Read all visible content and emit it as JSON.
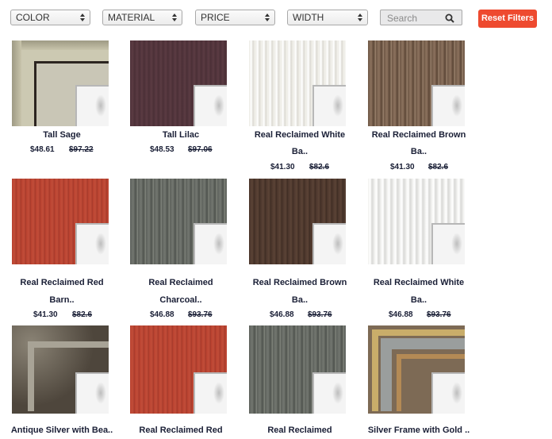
{
  "filters": {
    "color_label": "COLOR",
    "material_label": "MATERIAL",
    "price_label": "PRICE",
    "width_label": "WIDTH",
    "search_placeholder": "Search",
    "reset_label": "Reset Filters",
    "reset_color": "#ee4a2f"
  },
  "products": [
    {
      "name": "Tall Sage",
      "name2": "",
      "price": "$48.61",
      "old": "$97.22"
    },
    {
      "name": "Tall Lilac",
      "name2": "",
      "price": "$48.53",
      "old": "$97.06"
    },
    {
      "name": "Real Reclaimed White",
      "name2": "Ba..",
      "price": "$41.30",
      "old": "$82.6"
    },
    {
      "name": "Real Reclaimed Brown",
      "name2": "Ba..",
      "price": "$41.30",
      "old": "$82.6"
    },
    {
      "name": "Real Reclaimed Red",
      "name2": "Barn..",
      "price": "$41.30",
      "old": "$82.6"
    },
    {
      "name": "Real Reclaimed",
      "name2": "Charcoal..",
      "price": "$46.88",
      "old": "$93.76"
    },
    {
      "name": "Real Reclaimed Brown",
      "name2": "Ba..",
      "price": "$46.88",
      "old": "$93.76"
    },
    {
      "name": "Real Reclaimed White",
      "name2": "Ba..",
      "price": "$46.88",
      "old": "$93.76"
    },
    {
      "name": "Antique Silver with Bea..",
      "name2": "",
      "price": "",
      "old": ""
    },
    {
      "name": "Real Reclaimed Red",
      "name2": "",
      "price": "",
      "old": ""
    },
    {
      "name": "Real Reclaimed",
      "name2": "",
      "price": "",
      "old": ""
    },
    {
      "name": "Silver Frame with Gold ..",
      "name2": "",
      "price": "",
      "old": ""
    }
  ]
}
